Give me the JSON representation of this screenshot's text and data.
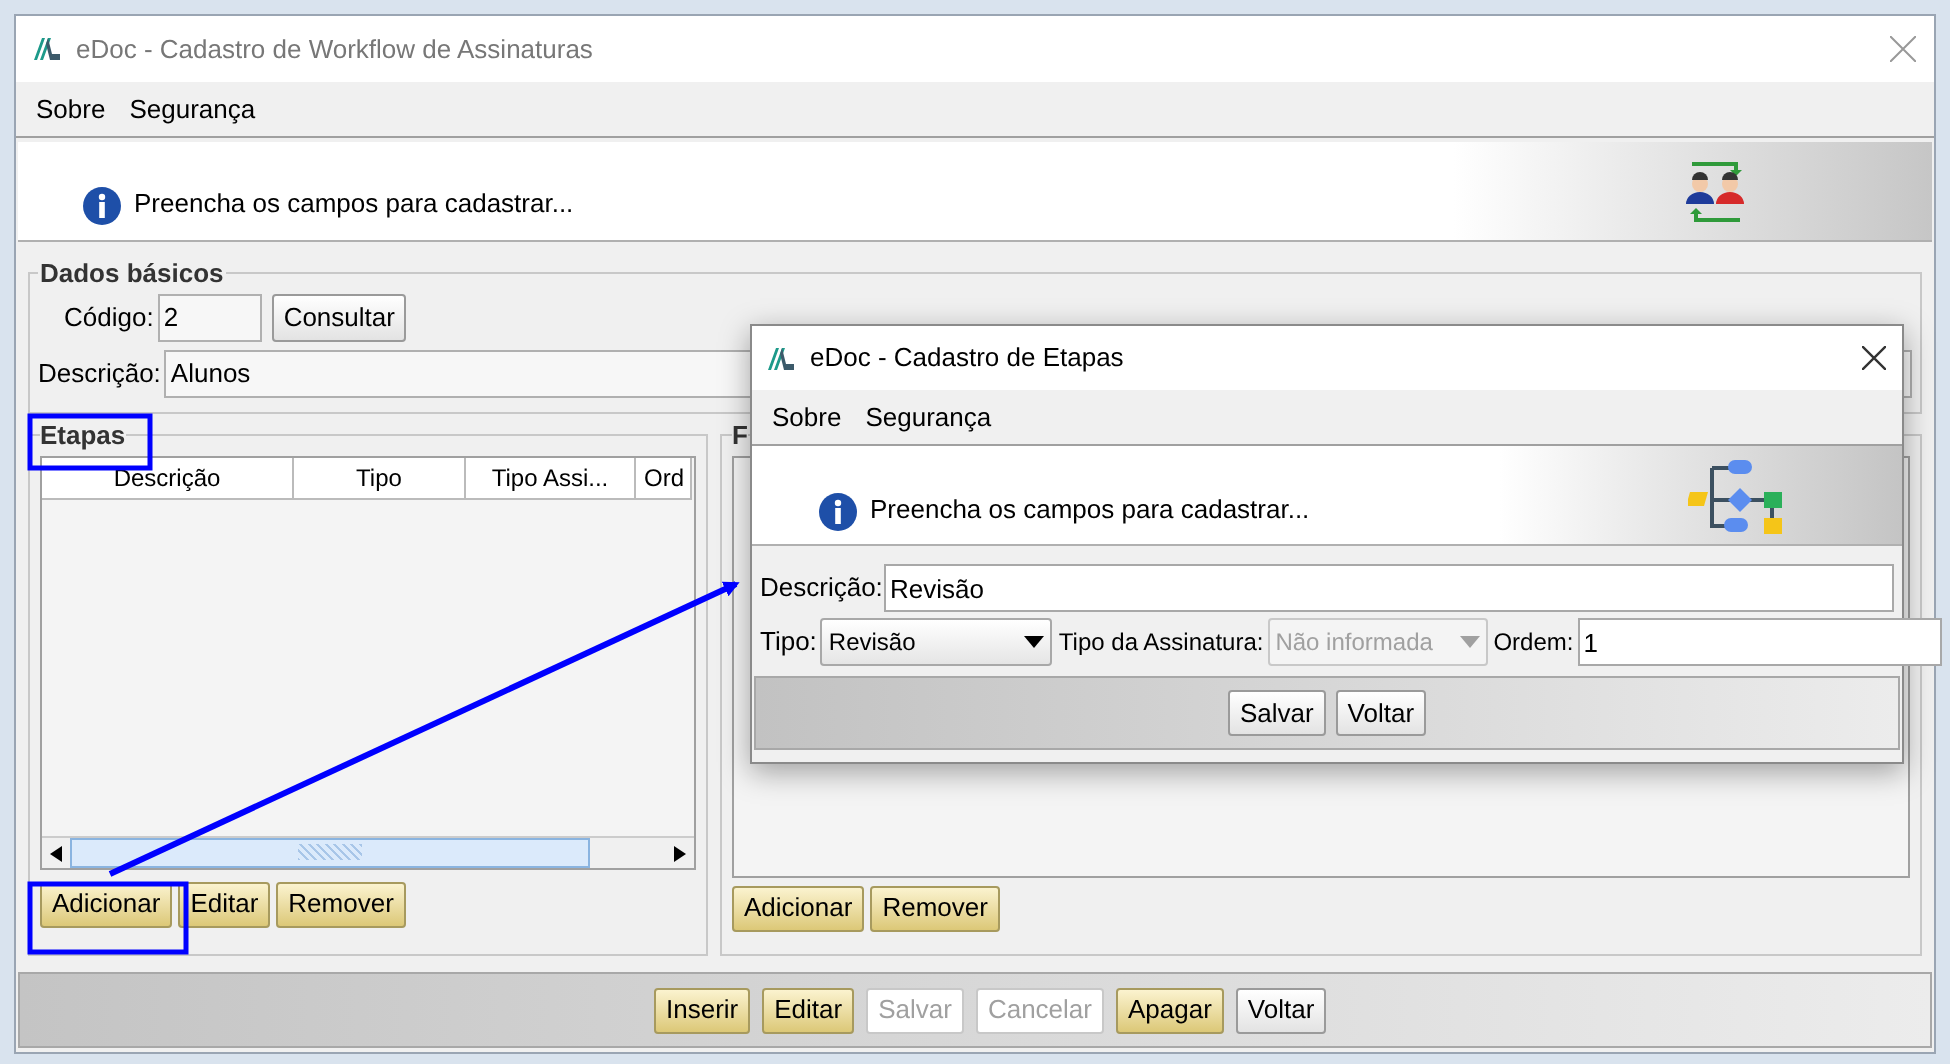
{
  "window": {
    "title": "eDoc - Cadastro de Workflow de Assinaturas"
  },
  "menu": [
    "Sobre",
    "Segurança"
  ],
  "banner": {
    "message": "Preencha os campos para cadastrar..."
  },
  "basic_data": {
    "title": "Dados básicos",
    "code_label": "Código:",
    "code_value": "2",
    "lookup_button": "Consultar",
    "description_label": "Descrição:",
    "description_value": "Alunos"
  },
  "steps": {
    "title": "Etapas",
    "columns": [
      "Descrição",
      "Tipo",
      "Tipo Assi...",
      "Ord"
    ],
    "buttons": [
      {
        "label": "Adicionar",
        "kind": "accent"
      },
      {
        "label": "Editar",
        "kind": "accent"
      },
      {
        "label": "Remover",
        "kind": "accent"
      }
    ]
  },
  "panel_2": {
    "title": "F",
    "buttons": [
      {
        "label": "Adicionar",
        "kind": "accent"
      },
      {
        "label": "Remover",
        "kind": "accent"
      }
    ]
  },
  "footer_buttons": [
    {
      "label": "Inserir",
      "kind": "accent",
      "disabled": false
    },
    {
      "label": "Editar",
      "kind": "accent",
      "disabled": false
    },
    {
      "label": "Salvar",
      "kind": "plain",
      "disabled": true
    },
    {
      "label": "Cancelar",
      "kind": "plain",
      "disabled": true
    },
    {
      "label": "Apagar",
      "kind": "accent",
      "disabled": false
    },
    {
      "label": "Voltar",
      "kind": "plain",
      "disabled": false
    }
  ],
  "dialog": {
    "title": "eDoc - Cadastro de Etapas",
    "menu": [
      "Sobre",
      "Segurança"
    ],
    "banner": {
      "message": "Preencha os campos para cadastrar..."
    },
    "description_label": "Descrição:",
    "description_value": "Revisão",
    "type_label": "Tipo:",
    "type_value": "Revisão",
    "type_disabled": false,
    "signature_label": "Tipo da Assinatura:",
    "signature_value": "Não informada",
    "signature_disabled": true,
    "order_label": "Ordem:",
    "order_value": "1",
    "buttons": [
      {
        "label": "Salvar",
        "kind": "plain",
        "disabled": false
      },
      {
        "label": "Voltar",
        "kind": "plain",
        "disabled": false
      }
    ]
  }
}
